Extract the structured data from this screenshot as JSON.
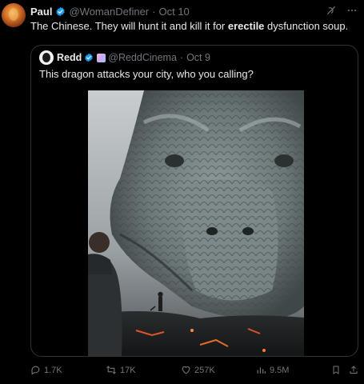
{
  "tweet": {
    "author_name": "Paul",
    "handle": "@WomanDefiner",
    "date": "Oct 10",
    "text_before": "The Chinese. They will hunt it and kill it for ",
    "text_bold": "erectile",
    "text_after": " dysfunction soup."
  },
  "quote": {
    "author_name": "Redd",
    "handle": "@ReddCinema",
    "date": "Oct 9",
    "text": "This dragon attacks your city, who you calling?"
  },
  "actions": {
    "replies": "1.7K",
    "reposts": "17K",
    "likes": "257K",
    "views": "9.5M"
  },
  "colors": {
    "background": "#000000",
    "text": "#e7e9ea",
    "muted": "#71767b",
    "verified": "#1d9bf0",
    "border": "#2f3336"
  },
  "icons": [
    "grok-icon",
    "more-icon",
    "reply-icon",
    "repost-icon",
    "like-icon",
    "views-icon",
    "bookmark-icon",
    "share-icon",
    "verified-icon"
  ]
}
